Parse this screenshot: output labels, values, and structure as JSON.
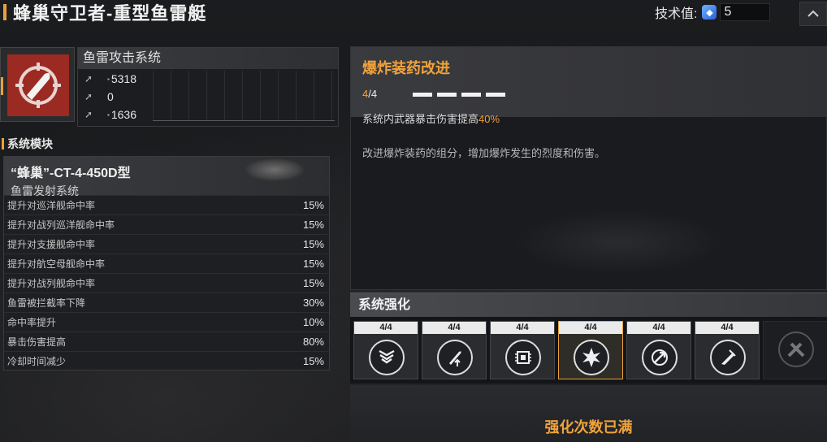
{
  "header": {
    "title": "蜂巢守卫者-重型鱼雷艇",
    "tech_label": "技术值:",
    "tech_value": "5"
  },
  "weapon": {
    "name": "鱼雷攻击系统",
    "stats": [
      {
        "icon": "damage-icon",
        "value": "5318"
      },
      {
        "icon": "range-icon",
        "value": "0"
      },
      {
        "icon": "speed-icon",
        "value": "1636"
      }
    ]
  },
  "modules": {
    "heading": "系统模块",
    "card": {
      "title": "“蜂巢”-CT-4-450D型",
      "subtitle": "鱼雷发射系统",
      "rows": [
        {
          "label": "提升对巡洋舰命中率",
          "value": "15%"
        },
        {
          "label": "提升对战列巡洋舰命中率",
          "value": "15%"
        },
        {
          "label": "提升对支援舰命中率",
          "value": "15%"
        },
        {
          "label": "提升对航空母舰命中率",
          "value": "15%"
        },
        {
          "label": "提升对战列舰命中率",
          "value": "15%"
        },
        {
          "label": "鱼雷被拦截率下降",
          "value": "30%"
        },
        {
          "label": "命中率提升",
          "value": "10%"
        },
        {
          "label": "暴击伤害提高",
          "value": "80%"
        },
        {
          "label": "冷却时间减少",
          "value": "15%"
        }
      ]
    }
  },
  "detail": {
    "title": "爆炸装药改进",
    "level_current": "4",
    "level_total": "/4",
    "level_fraction": 1.0,
    "effect_prefix": "系统内武器暴击伤害提高",
    "effect_value": "40%",
    "description": "改进爆炸装药的组分，增加爆炸发生的烈度和伤害。"
  },
  "enhance": {
    "heading": "系统强化",
    "slots": [
      {
        "level": "4/4",
        "icon": "shield-badge-icon",
        "selected": false
      },
      {
        "level": "4/4",
        "icon": "missile-up-icon",
        "selected": false
      },
      {
        "level": "4/4",
        "icon": "chip-icon",
        "selected": false
      },
      {
        "level": "4/4",
        "icon": "explosion-icon",
        "selected": true
      },
      {
        "level": "4/4",
        "icon": "target-arrow-icon",
        "selected": false
      },
      {
        "level": "4/4",
        "icon": "torpedo-launch-icon",
        "selected": false
      }
    ],
    "locked_icon": "crossed-torpedo-icon",
    "maxed_text": "强化次数已满"
  },
  "colors": {
    "accent": "#f0a33b",
    "weapon_bg": "#9b2a22"
  }
}
